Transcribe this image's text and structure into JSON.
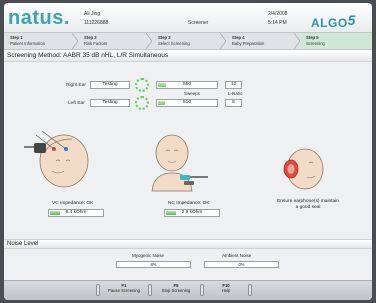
{
  "header": {
    "brand": "natus.",
    "product": "ALGO",
    "product_version": "5",
    "patient_name": "Ali Jing",
    "patient_id": "111226888",
    "screener_label": "Screener",
    "date": "2/4/2008",
    "time": "5:14 PM"
  },
  "steps": [
    {
      "num": "Step 1",
      "label": "Patient Information"
    },
    {
      "num": "Step 2",
      "label": "Risk Factors"
    },
    {
      "num": "Step 3",
      "label": "Select Screening"
    },
    {
      "num": "Step 4",
      "label": "Baby Preparation"
    },
    {
      "num": "Step 5",
      "label": "Screening"
    }
  ],
  "method": {
    "title": "Screening Method: AABR 35 dB nHL, L/R Simultaneous"
  },
  "ears": {
    "sweeps_header": "Sweeps",
    "lratio_header": "L-Ratio",
    "right": {
      "label": "Right Ear",
      "status": "Testing",
      "sweeps": "550",
      "sweeps_fraction": 0.14,
      "lratio": "12"
    },
    "left": {
      "label": "Left Ear",
      "status": "Testing",
      "sweeps": "510",
      "sweeps_fraction": 0.12,
      "lratio": "6"
    }
  },
  "impedance": {
    "vc": {
      "label": "VC Impedance:  OK",
      "value": "6.4 kOhm"
    },
    "nc": {
      "label": "NC Impedance:  OK",
      "value": "2.9 kOhm"
    }
  },
  "earphone_note": {
    "line1": "Ensure earphone(s) maintain",
    "line2": "a good seal"
  },
  "noise": {
    "title": "Noise Level",
    "myogenic_label": "Myogenic Noise",
    "myogenic_value": "8%",
    "ambient_label": "Ambient Noise",
    "ambient_value": "0%"
  },
  "fkeys": [
    {
      "key": "F1",
      "label": "Pause Screening"
    },
    {
      "key": "F5",
      "label": "Stop Screening"
    },
    {
      "key": "F10",
      "label": "Help"
    }
  ],
  "colors": {
    "brand": "#3fa3ad",
    "accent_green": "#7ec86a",
    "active_step": "#cfe9d6"
  }
}
